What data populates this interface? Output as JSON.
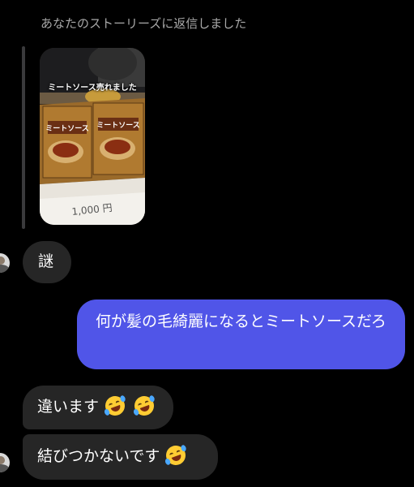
{
  "reply_header": "あなたのストーリーズに返信しました",
  "story": {
    "caption": "ミートソース売れました",
    "package_text": "ミートソース",
    "price_text": "1,000 円"
  },
  "messages": [
    {
      "direction": "incoming",
      "text": "謎"
    },
    {
      "direction": "outgoing",
      "text": "何が髪の毛綺麗になるとミートソースだろ"
    },
    {
      "direction": "incoming",
      "text": "違います",
      "emoji": [
        "rolling-on-floor-laughing-emoji",
        "rolling-on-floor-laughing-emoji"
      ]
    },
    {
      "direction": "incoming",
      "text": "結びつかないです",
      "emoji": [
        "rolling-on-floor-laughing-emoji"
      ]
    }
  ],
  "colors": {
    "background": "#000000",
    "incoming_bubble": "#262626",
    "outgoing_bubble": "#5055e8",
    "header_text": "#a8a8a8"
  }
}
